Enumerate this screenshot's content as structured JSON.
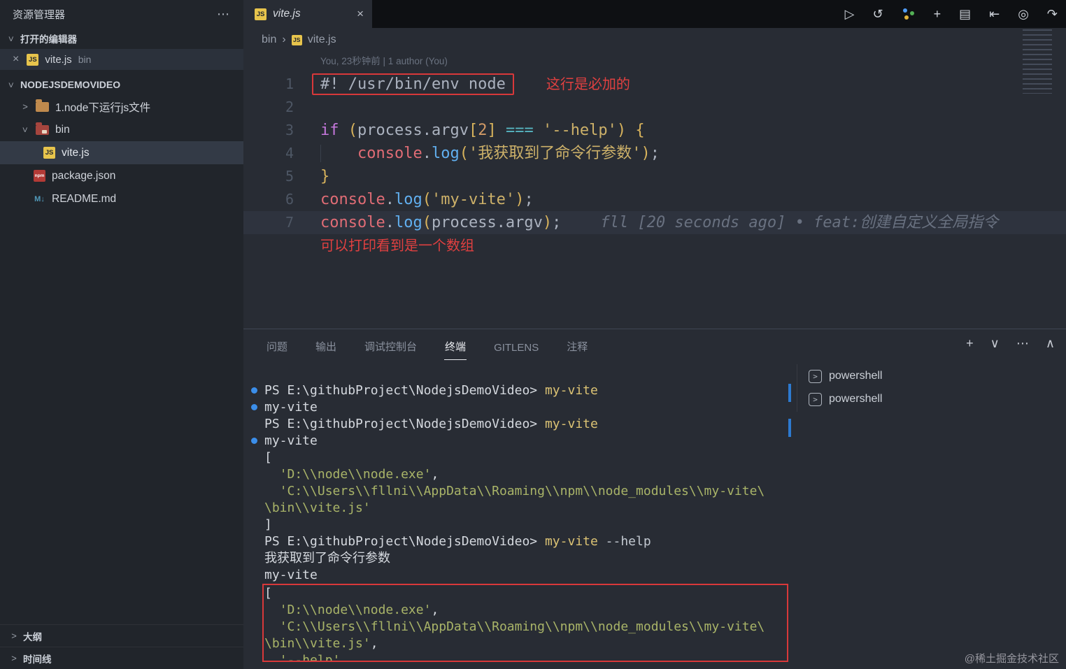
{
  "window": {
    "watermark": "@稀土掘金技术社区"
  },
  "colors": {
    "annotation_red": "#d8383a",
    "command_dot_blue": "#3b8eea",
    "js_icon_yellow": "#e7c44c",
    "string_yellow": "#cdb169",
    "keyword_purple": "#c678dd",
    "function_blue": "#61afef",
    "variable_red": "#e06c75",
    "selected_row": "#333a46"
  },
  "icons": {
    "run": "▷",
    "history": "↺",
    "new_file": "+",
    "layout": "▤",
    "dock": "⇤",
    "target": "◎",
    "forward": "↷",
    "more": "⋯",
    "close": "×",
    "panel_new": "+",
    "panel_dropdown": "∨",
    "panel_more": "⋯",
    "panel_up": "∧",
    "chevron_right": ">",
    "breadcrumb_sep": "›",
    "js_badge": "JS",
    "npm_badge": "npm",
    "md_badge": "M↓",
    "terminal_prompt": ">"
  },
  "sidebar": {
    "title": "资源管理器",
    "open_editors": {
      "label": "打开的编辑器",
      "item": {
        "name": "vite.js",
        "detail": "bin"
      }
    },
    "project": {
      "label": "NODEJSDEMOVIDEO",
      "items": {
        "folder1": "1.node下运行js文件",
        "folder2": "bin",
        "file_vite": "vite.js",
        "file_package": "package.json",
        "file_readme": "README.md"
      }
    },
    "outline_label": "大纲",
    "timeline_label": "时间线"
  },
  "tabbar": {
    "tab": {
      "label": "vite.js"
    }
  },
  "editor": {
    "breadcrumb": {
      "folder": "bin",
      "file": "vite.js"
    },
    "codelens": "You, 23秒钟前 | 1 author (You)",
    "blame": "fll [20 seconds ago] • feat:创建自定义全局指令",
    "lines": [
      {
        "n": "1",
        "boxed": true,
        "annotation": "这行是必加的",
        "tokens": [
          [
            "plain",
            "#! /usr/bin/env node"
          ]
        ]
      },
      {
        "n": "2",
        "tokens": []
      },
      {
        "n": "3",
        "tokens": [
          [
            "kw",
            "if"
          ],
          [
            "plain",
            " "
          ],
          [
            "paren",
            "("
          ],
          [
            "plain",
            "process.argv"
          ],
          [
            "paren",
            "["
          ],
          [
            "num",
            "2"
          ],
          [
            "paren",
            "]"
          ],
          [
            "plain",
            " "
          ],
          [
            "op",
            "==="
          ],
          [
            "plain",
            " "
          ],
          [
            "str",
            "'--help'"
          ],
          [
            "paren",
            ")"
          ],
          [
            "plain",
            " "
          ],
          [
            "paren",
            "{"
          ]
        ]
      },
      {
        "n": "4",
        "tokens": [
          [
            "indent",
            "    "
          ],
          [
            "var",
            "console"
          ],
          [
            "plain",
            "."
          ],
          [
            "fn",
            "log"
          ],
          [
            "paren",
            "("
          ],
          [
            "str",
            "'我获取到了命令行参数'"
          ],
          [
            "paren",
            ")"
          ],
          [
            "plain",
            ";"
          ]
        ]
      },
      {
        "n": "5",
        "tokens": [
          [
            "paren",
            "}"
          ]
        ]
      },
      {
        "n": "6",
        "tokens": [
          [
            "var",
            "console"
          ],
          [
            "plain",
            "."
          ],
          [
            "fn",
            "log"
          ],
          [
            "paren",
            "("
          ],
          [
            "str",
            "'my-vite'"
          ],
          [
            "paren",
            ")"
          ],
          [
            "plain",
            ";"
          ]
        ]
      },
      {
        "n": "7",
        "current": true,
        "blame": true,
        "tokens": [
          [
            "var",
            "console"
          ],
          [
            "plain",
            "."
          ],
          [
            "fn",
            "log"
          ],
          [
            "paren",
            "("
          ],
          [
            "plain",
            "process.argv"
          ],
          [
            "paren",
            ")"
          ],
          [
            "plain",
            ";"
          ]
        ]
      },
      {
        "n": "",
        "note": "可以打印看到是一个数组",
        "tokens": []
      }
    ]
  },
  "panel": {
    "tabs": [
      "问题",
      "输出",
      "调试控制台",
      "终端",
      "GITLENS",
      "注释"
    ],
    "active_tab": "终端",
    "terminal": {
      "list": [
        "powershell",
        "powershell"
      ],
      "lines": [
        {
          "dot": true,
          "tokens": [
            [
              "prompt",
              "PS E:\\githubProject\\NodejsDemoVideo> "
            ],
            [
              "cmd",
              "my-vite"
            ]
          ]
        },
        {
          "dot": true,
          "tokens": [
            [
              "out",
              "my-vite"
            ]
          ]
        },
        {
          "tokens": [
            [
              "prompt",
              "PS E:\\githubProject\\NodejsDemoVideo> "
            ],
            [
              "cmd",
              "my-vite"
            ]
          ]
        },
        {
          "dot": true,
          "tokens": [
            [
              "out",
              "my-vite"
            ]
          ]
        },
        {
          "tokens": [
            [
              "out",
              "["
            ]
          ]
        },
        {
          "tokens": [
            [
              "out",
              "  "
            ],
            [
              "str",
              "'D:\\\\node\\\\node.exe'"
            ],
            [
              "out",
              ","
            ]
          ]
        },
        {
          "tokens": [
            [
              "out",
              "  "
            ],
            [
              "str",
              "'C:\\\\Users\\\\fllni\\\\AppData\\\\Roaming\\\\npm\\\\node_modules\\\\my-vite\\"
            ]
          ]
        },
        {
          "tokens": [
            [
              "str",
              "\\bin\\\\vite.js'"
            ]
          ]
        },
        {
          "tokens": [
            [
              "out",
              "]"
            ]
          ]
        },
        {
          "tokens": [
            [
              "prompt",
              "PS E:\\githubProject\\NodejsDemoVideo> "
            ],
            [
              "cmd",
              "my-vite"
            ],
            [
              "arg",
              " --help"
            ]
          ]
        },
        {
          "tokens": [
            [
              "out",
              "我获取到了命令行参数"
            ]
          ]
        },
        {
          "tokens": [
            [
              "out",
              "my-vite"
            ]
          ]
        },
        {
          "box": true,
          "tokens": [
            [
              "out",
              "["
            ]
          ]
        },
        {
          "box": true,
          "tokens": [
            [
              "out",
              "  "
            ],
            [
              "str",
              "'D:\\\\node\\\\node.exe'"
            ],
            [
              "out",
              ","
            ]
          ]
        },
        {
          "box": true,
          "tokens": [
            [
              "out",
              "  "
            ],
            [
              "str",
              "'C:\\\\Users\\\\fllni\\\\AppData\\\\Roaming\\\\npm\\\\node_modules\\\\my-vite\\"
            ]
          ]
        },
        {
          "box": true,
          "tokens": [
            [
              "str",
              "\\bin\\\\vite.js'"
            ],
            [
              "out",
              ","
            ]
          ]
        },
        {
          "box": true,
          "tokens": [
            [
              "out",
              "  "
            ],
            [
              "str",
              "'--help'"
            ]
          ]
        }
      ]
    }
  }
}
